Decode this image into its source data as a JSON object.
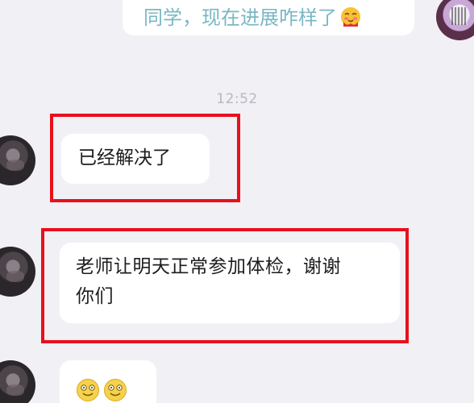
{
  "messages": {
    "outgoing": {
      "text": "同学，现在进展咋样了",
      "emoji": "blushing-face-emoji"
    },
    "timestamp": "12:52",
    "incoming": [
      {
        "text": "已经解决了"
      },
      {
        "text_line1": "老师让明天正常参加体检，谢谢",
        "text_line2": "你们"
      },
      {
        "emojis": [
          "smiling-face-emoji",
          "smiling-face-emoji"
        ]
      }
    ]
  },
  "colors": {
    "background": "#f1f0f5",
    "bubble": "#ffffff",
    "outgoing_text": "#7ab7c4",
    "highlight": "#e8101c"
  }
}
